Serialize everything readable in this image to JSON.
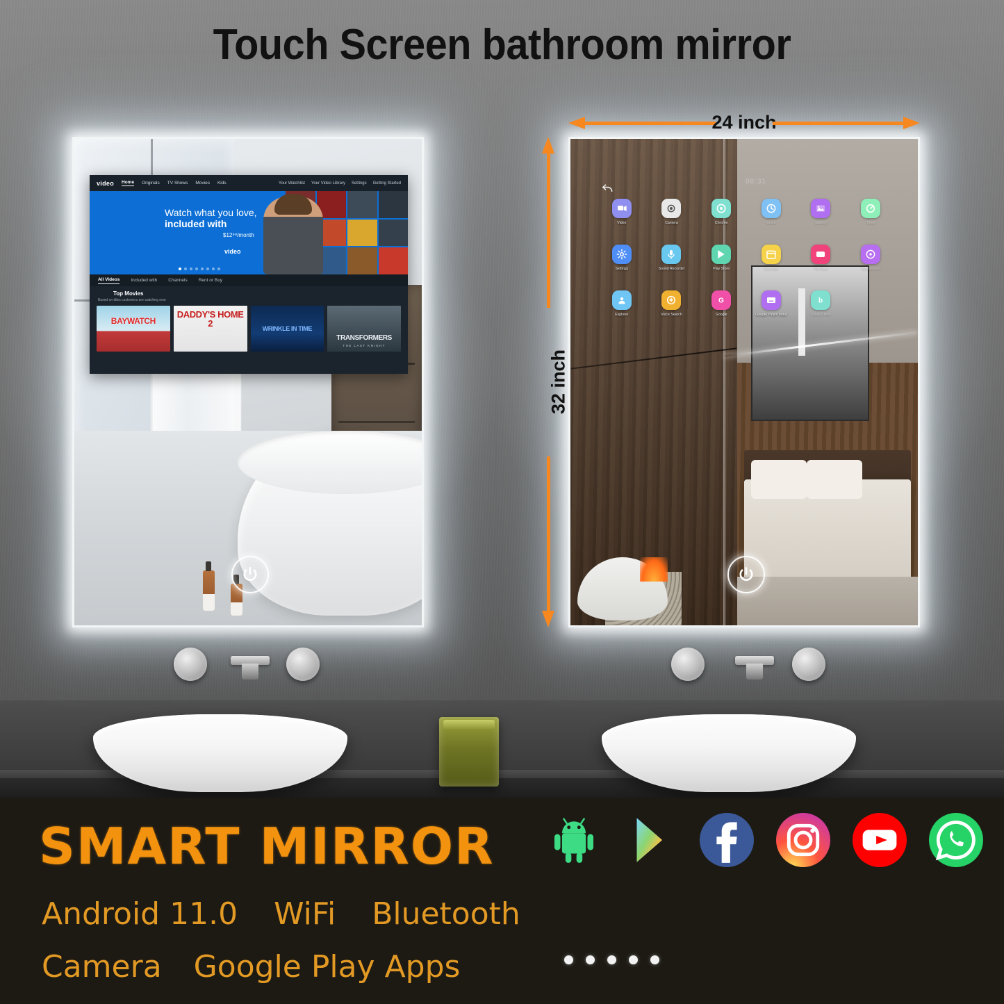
{
  "title": "Touch Screen bathroom mirror",
  "dimensions": {
    "width_label": "24 inch",
    "height_label": "32 inch",
    "arrow_color": "#f7871f"
  },
  "video_app": {
    "logo": "video",
    "nav_items": [
      "Home",
      "Originals",
      "TV Shows",
      "Movies",
      "Kids"
    ],
    "active_nav": "Home",
    "nav_right": [
      "Your Watchlist",
      "Your Video Library",
      "Settings",
      "Getting Started"
    ],
    "hero": {
      "line1": "Watch what you love,",
      "line2": "included with",
      "price": "$12⁹⁹/month",
      "brand": "video",
      "dot_count": 8,
      "active_dot": 1
    },
    "tabs": [
      "All Videos",
      "Included with",
      "Channels",
      "Rent or Buy"
    ],
    "active_tab": "All Videos",
    "section_title": "Top Movies",
    "section_subtitle": "Based on titles customers are watching now",
    "posters": [
      {
        "title": "BAYWATCH",
        "sub": ""
      },
      {
        "title": "DADDY'S HOME 2",
        "sub": ""
      },
      {
        "title": "WRINKLE IN TIME",
        "sub": ""
      },
      {
        "title": "TRANSFORMERS",
        "sub": "THE LAST KNIGHT"
      }
    ]
  },
  "launcher": {
    "clock": "08:31",
    "back_icon": "back-arrow-icon",
    "apps": [
      {
        "label": "Video",
        "icon": "video-camera-icon",
        "bg": "#8f8ff0",
        "fg": "#ffffff",
        "dim": false
      },
      {
        "label": "Camera",
        "icon": "camera-icon",
        "bg": "#e8e8e8",
        "fg": "#555555",
        "dim": false
      },
      {
        "label": "Chrome",
        "icon": "chrome-icon",
        "bg": "#7fe0cf",
        "fg": "#ffffff",
        "dim": false
      },
      {
        "label": "Clock",
        "icon": "clock-icon",
        "bg": "#7fc0f5",
        "fg": "#ffffff",
        "dim": true
      },
      {
        "label": "Gallery",
        "icon": "gallery-icon",
        "bg": "#b06ef0",
        "fg": "#ffffff",
        "dim": true
      },
      {
        "label": "Timer",
        "icon": "timer-icon",
        "bg": "#8ef0b8",
        "fg": "#ffffff",
        "dim": true
      },
      {
        "label": "Settings",
        "icon": "gear-icon",
        "bg": "#4f8ef7",
        "fg": "#ffffff",
        "dim": false
      },
      {
        "label": "Sound Recorder",
        "icon": "microphone-icon",
        "bg": "#69c8f0",
        "fg": "#ffffff",
        "dim": false
      },
      {
        "label": "Play Store",
        "icon": "play-store-icon",
        "bg": "#5fd6b0",
        "fg": "#ffffff",
        "dim": false
      },
      {
        "label": "Calendar",
        "icon": "calendar-icon",
        "bg": "#f5d24a",
        "fg": "#ffffff",
        "dim": true
      },
      {
        "label": "YouTube",
        "icon": "youtube-icon",
        "bg": "#f0437c",
        "fg": "#ffffff",
        "dim": true
      },
      {
        "label": "Soundcloud",
        "icon": "music-disc-icon",
        "bg": "#b86ef0",
        "fg": "#ffffff",
        "dim": true
      },
      {
        "label": "Explorer",
        "icon": "file-explorer-icon",
        "bg": "#6fc6f5",
        "fg": "#ffffff",
        "dim": false
      },
      {
        "label": "Voice Search",
        "icon": "voice-search-icon",
        "bg": "#f0b030",
        "fg": "#ffffff",
        "dim": false
      },
      {
        "label": "Google",
        "icon": "google-icon",
        "bg": "#f050a8",
        "fg": "#ffffff",
        "dim": false
      },
      {
        "label": "Google Pinyin Input",
        "icon": "keyboard-input-icon",
        "bg": "#b06ef0",
        "fg": "#ffffff",
        "dim": false
      },
      {
        "label": "Email Client",
        "icon": "email-icon",
        "bg": "#7fe0d0",
        "fg": "#ffffff",
        "dim": true
      }
    ]
  },
  "power_button": {
    "icon": "power-icon",
    "label": "Power"
  },
  "banner": {
    "brand": "SMART MIRROR",
    "brand_color": "#f2920f",
    "features_row1": [
      "Android 11.0",
      "WiFi",
      "Bluetooth"
    ],
    "features_row2": [
      "Camera",
      "Google Play Apps"
    ],
    "logos": [
      {
        "name": "android-logo",
        "color": "#3ddc84"
      },
      {
        "name": "google-play-logo",
        "color": "#00a0ff"
      },
      {
        "name": "facebook-logo",
        "color": "#3b5998"
      },
      {
        "name": "instagram-logo",
        "color": "#e1306c"
      },
      {
        "name": "youtube-logo",
        "color": "#ff0000"
      },
      {
        "name": "whatsapp-logo",
        "color": "#25d366"
      }
    ],
    "pager_dots": 5
  }
}
